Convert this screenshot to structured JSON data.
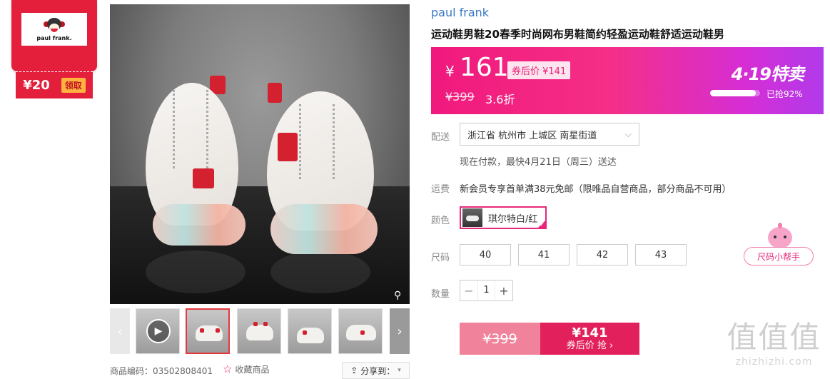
{
  "shop_badge": {
    "logo_text": "paul frank.",
    "coupon_amount": "¥20",
    "claim_label": "领取"
  },
  "product": {
    "brand": "paul frank",
    "title": "运动鞋男鞋20春季时尚网布男鞋简约轻盈运动鞋舒适运动鞋男"
  },
  "price": {
    "currency": "¥",
    "current": "161",
    "coupon_price": "券后价 ¥141",
    "original": "¥399",
    "discount": "3.6折",
    "promo_title": "4·19特卖",
    "sold_percent": 92,
    "sold_text": "已抢92%"
  },
  "delivery": {
    "label": "配送",
    "address": "浙江省 杭州市 上城区 南星街道",
    "note": "现在付款，最快4月21日（周三）送达"
  },
  "shipping": {
    "label": "运费",
    "text": "新会员专享首单满38元免邮（限唯品自营商品，部分商品不可用）"
  },
  "color": {
    "label": "颜色",
    "selected": "琪尔特白/红"
  },
  "size": {
    "label": "尺码",
    "options": [
      "40",
      "41",
      "42",
      "43"
    ],
    "helper_label": "尺码小帮手"
  },
  "quantity": {
    "label": "数量",
    "value": "1",
    "minus": "−",
    "plus": "+"
  },
  "buy": {
    "original_price": "¥399",
    "coupon_price": "¥141",
    "action_label": "券后价 抢 ›"
  },
  "gallery": {
    "prev_arrow": "‹",
    "next_arrow": "›",
    "play_icon": "▶"
  },
  "footer": {
    "product_code": "商品编码：03502808401",
    "favorite_label": "收藏商品",
    "share_label": "分享到："
  },
  "watermark": {
    "big": "值值值",
    "small": "zhizhizhi.com"
  }
}
